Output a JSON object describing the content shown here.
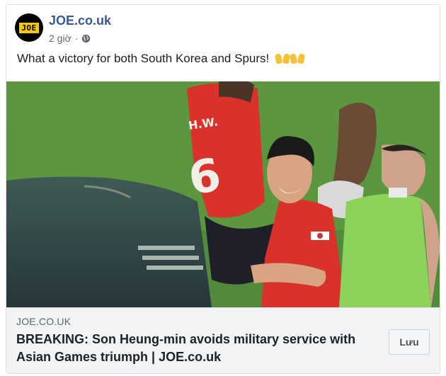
{
  "post": {
    "page_name": "JOE.co.uk",
    "avatar_text": "JOE",
    "time": "2 giờ",
    "audience_icon": "globe-icon",
    "message": "What a victory for both South Korea and Spurs!",
    "emoji": "raising-hands-emoji"
  },
  "photo": {
    "jersey_text": "H.W.",
    "jersey_number": "6"
  },
  "link": {
    "domain": "JOE.CO.UK",
    "headline": "BREAKING: Son Heung-min avoids military service with Asian Games triumph | JOE.co.uk",
    "save_label": "Lưu"
  },
  "colors": {
    "page_name": "#385898",
    "brand_yellow": "#f6c800",
    "jersey_red": "#d9322b",
    "bib_green": "#8bd35a"
  }
}
